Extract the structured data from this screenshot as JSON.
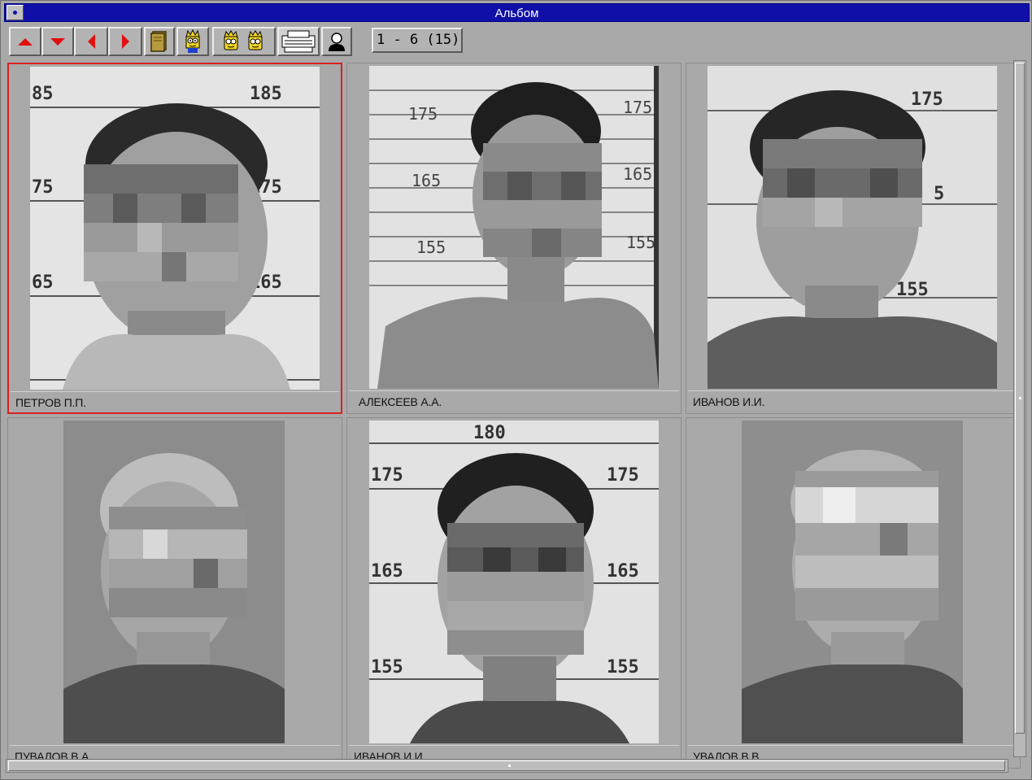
{
  "window": {
    "title": "Альбом"
  },
  "toolbar": {
    "buttons": [
      {
        "name": "scroll-up-button",
        "icon": "arrow-up-icon"
      },
      {
        "name": "scroll-down-button",
        "icon": "arrow-down-icon"
      },
      {
        "name": "previous-page-button",
        "icon": "arrow-left-icon"
      },
      {
        "name": "next-page-button",
        "icon": "arrow-right-icon"
      },
      {
        "name": "book-button",
        "icon": "book-icon"
      },
      {
        "name": "single-person-button",
        "icon": "cartoon-face-icon"
      },
      {
        "name": "two-persons-button",
        "icon": "cartoon-faces-icon"
      },
      {
        "name": "print-button",
        "icon": "printer-icon"
      },
      {
        "name": "person-profile-button",
        "icon": "person-silhouette-icon"
      }
    ],
    "counter": "1 - 6 (15)"
  },
  "album": {
    "items": [
      {
        "caption": "ПЕТРОВ П.П.",
        "selected": true
      },
      {
        "caption": "АЛЕКСЕЕВ А.А.",
        "selected": false
      },
      {
        "caption": "ИВАНОВ И.И.",
        "selected": false
      },
      {
        "caption": "ПУВАЛОВ В.А.",
        "selected": false
      },
      {
        "caption": "ИВАНОВ И.И.",
        "selected": false
      },
      {
        "caption": "УВАЛОВ В.В.",
        "selected": false
      }
    ]
  },
  "colors": {
    "accent": "#1010a8",
    "selection": "#d82020",
    "arrow": "#e01010",
    "background": "#a9a9a9"
  }
}
